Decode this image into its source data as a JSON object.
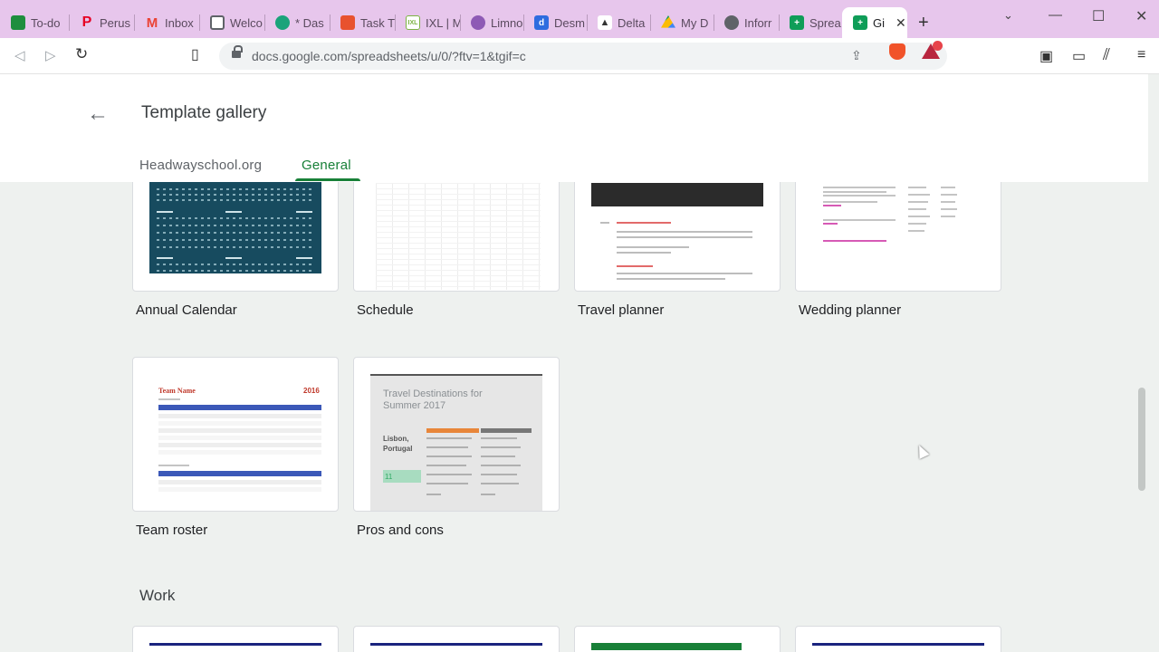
{
  "browser": {
    "tabs": [
      {
        "label": "To-do",
        "favicon": "classroom-icon",
        "color": "#1e8e3e"
      },
      {
        "label": "Perus",
        "favicon": "pinterest-icon",
        "color": "#e60023"
      },
      {
        "label": "Inbox",
        "favicon": "gmail-icon",
        "color": "#ea4335"
      },
      {
        "label": "Welco",
        "favicon": "doc-icon",
        "color": "#5f6368"
      },
      {
        "label": "* Das",
        "favicon": "hexagon-icon",
        "color": "#1aa37a"
      },
      {
        "label": "Task T",
        "favicon": "task-icon",
        "color": "#e8522f"
      },
      {
        "label": "IXL | M",
        "favicon": "ixl-icon",
        "color": "#7cb342"
      },
      {
        "label": "Limno",
        "favicon": "cloud-icon",
        "color": "#8e5ab5"
      },
      {
        "label": "Desm",
        "favicon": "desmos-icon",
        "color": "#2e6cdf"
      },
      {
        "label": "Delta",
        "favicon": "graduation-cap-icon",
        "color": "#333333"
      },
      {
        "label": "My D",
        "favicon": "drive-icon",
        "color": "#fbbc04"
      },
      {
        "label": "Inforr",
        "favicon": "globe-icon",
        "color": "#5f6368"
      },
      {
        "label": "Sprea",
        "favicon": "sheets-icon",
        "color": "#0f9d58"
      },
      {
        "label": "Gi",
        "favicon": "sheets-icon",
        "color": "#0f9d58",
        "active": true
      }
    ],
    "url": "docs.google.com/spreadsheets/u/0/?ftv=1&tgif=c"
  },
  "header": {
    "title": "Template gallery",
    "tabs": [
      {
        "label": "Headwayschool.org"
      },
      {
        "label": "General",
        "selected": true
      }
    ]
  },
  "templates": [
    {
      "label": "Annual Calendar"
    },
    {
      "label": "Schedule"
    },
    {
      "label": "Travel planner"
    },
    {
      "label": "Wedding planner"
    },
    {
      "label": "Team roster"
    },
    {
      "label": "Pros and cons"
    }
  ],
  "thumbs": {
    "roster_title": "Team Name",
    "roster_year": "2016",
    "pc_title": "Travel Destinations for Summer 2017",
    "pc_city": "Lisbon, Portugal",
    "pc_number": "11"
  },
  "sections": {
    "work": "Work"
  },
  "colors": {
    "accent": "#188038",
    "tabstrip": "#e7c6ec"
  }
}
